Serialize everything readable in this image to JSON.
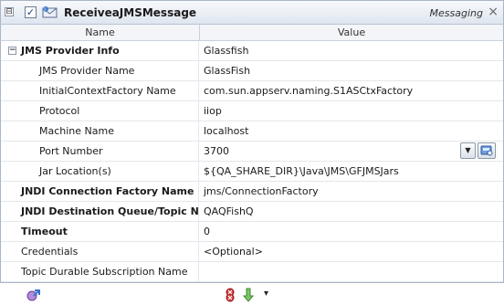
{
  "header": {
    "collapse": "⊟",
    "checked": "✓",
    "title": "ReceiveaJMSMessage",
    "category": "Messaging",
    "close": "×",
    "icon": "jms-message-icon"
  },
  "columns": {
    "name": "Name",
    "value": "Value"
  },
  "rows": [
    {
      "name": "JMS Provider Info",
      "value": "Glassfish"
    },
    {
      "name": "JMS Provider Name",
      "value": "GlassFish"
    },
    {
      "name": "InitialContextFactory Name",
      "value": "com.sun.appserv.naming.S1ASCtxFactory"
    },
    {
      "name": "Protocol",
      "value": "iiop"
    },
    {
      "name": "Machine Name",
      "value": "localhost"
    },
    {
      "name": "Port Number",
      "value": "3700"
    },
    {
      "name": "Jar Location(s)",
      "value": "${QA_SHARE_DIR}\\Java\\JMS\\GFJMSJars"
    },
    {
      "name": "JNDI Connection Factory Name",
      "value": "jms/ConnectionFactory"
    },
    {
      "name": "JNDI Destination Queue/Topic Na",
      "value": "QAQFishQ"
    },
    {
      "name": "Timeout",
      "value": "0"
    },
    {
      "name": "Credentials",
      "value": "<Optional>"
    },
    {
      "name": "Topic Durable Subscription Name",
      "value": ""
    }
  ],
  "expander": "−",
  "port_dropdown": "▼",
  "footer": {
    "icons": [
      "connect-icon",
      "stop-icon",
      "arrow-down-icon",
      "dropdown-arrow-icon"
    ],
    "dropdown": "▾"
  },
  "colors": {
    "accent": "#1a3c80",
    "border": "#a9b6c6",
    "header_bg": "#dfe6ef"
  }
}
